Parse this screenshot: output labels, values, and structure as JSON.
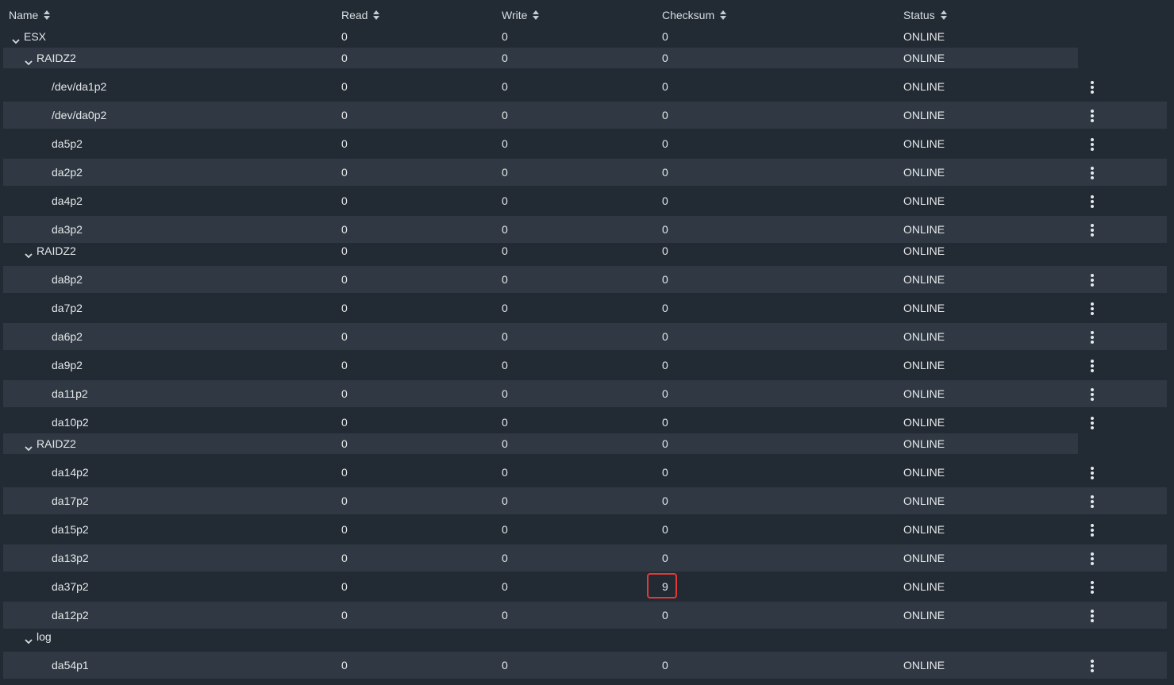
{
  "columns": {
    "name": "Name",
    "read": "Read",
    "write": "Write",
    "checksum": "Checksum",
    "status": "Status"
  },
  "accent": {
    "highlight_border": "#e53935",
    "row_alt_bg": "#303943",
    "page_bg": "#222a33"
  },
  "rows": [
    {
      "kind": "pool",
      "name": "ESX",
      "read": "0",
      "write": "0",
      "checksum": "0",
      "status": "ONLINE"
    },
    {
      "kind": "vdev",
      "name": "RAIDZ2",
      "read": "0",
      "write": "0",
      "checksum": "0",
      "status": "ONLINE"
    },
    {
      "kind": "disk",
      "name": "/dev/da1p2",
      "read": "0",
      "write": "0",
      "checksum": "0",
      "status": "ONLINE"
    },
    {
      "kind": "disk",
      "name": "/dev/da0p2",
      "read": "0",
      "write": "0",
      "checksum": "0",
      "status": "ONLINE"
    },
    {
      "kind": "disk",
      "name": "da5p2",
      "read": "0",
      "write": "0",
      "checksum": "0",
      "status": "ONLINE"
    },
    {
      "kind": "disk",
      "name": "da2p2",
      "read": "0",
      "write": "0",
      "checksum": "0",
      "status": "ONLINE"
    },
    {
      "kind": "disk",
      "name": "da4p2",
      "read": "0",
      "write": "0",
      "checksum": "0",
      "status": "ONLINE"
    },
    {
      "kind": "disk",
      "name": "da3p2",
      "read": "0",
      "write": "0",
      "checksum": "0",
      "status": "ONLINE"
    },
    {
      "kind": "vdev",
      "name": "RAIDZ2",
      "read": "0",
      "write": "0",
      "checksum": "0",
      "status": "ONLINE"
    },
    {
      "kind": "disk",
      "name": "da8p2",
      "read": "0",
      "write": "0",
      "checksum": "0",
      "status": "ONLINE"
    },
    {
      "kind": "disk",
      "name": "da7p2",
      "read": "0",
      "write": "0",
      "checksum": "0",
      "status": "ONLINE"
    },
    {
      "kind": "disk",
      "name": "da6p2",
      "read": "0",
      "write": "0",
      "checksum": "0",
      "status": "ONLINE"
    },
    {
      "kind": "disk",
      "name": "da9p2",
      "read": "0",
      "write": "0",
      "checksum": "0",
      "status": "ONLINE"
    },
    {
      "kind": "disk",
      "name": "da11p2",
      "read": "0",
      "write": "0",
      "checksum": "0",
      "status": "ONLINE"
    },
    {
      "kind": "disk",
      "name": "da10p2",
      "read": "0",
      "write": "0",
      "checksum": "0",
      "status": "ONLINE"
    },
    {
      "kind": "vdev",
      "name": "RAIDZ2",
      "read": "0",
      "write": "0",
      "checksum": "0",
      "status": "ONLINE"
    },
    {
      "kind": "disk",
      "name": "da14p2",
      "read": "0",
      "write": "0",
      "checksum": "0",
      "status": "ONLINE"
    },
    {
      "kind": "disk",
      "name": "da17p2",
      "read": "0",
      "write": "0",
      "checksum": "0",
      "status": "ONLINE"
    },
    {
      "kind": "disk",
      "name": "da15p2",
      "read": "0",
      "write": "0",
      "checksum": "0",
      "status": "ONLINE"
    },
    {
      "kind": "disk",
      "name": "da13p2",
      "read": "0",
      "write": "0",
      "checksum": "0",
      "status": "ONLINE"
    },
    {
      "kind": "disk",
      "name": "da37p2",
      "read": "0",
      "write": "0",
      "checksum": "9",
      "status": "ONLINE",
      "highlighted": true
    },
    {
      "kind": "disk",
      "name": "da12p2",
      "read": "0",
      "write": "0",
      "checksum": "0",
      "status": "ONLINE"
    },
    {
      "kind": "vdev",
      "name": "log",
      "read": "",
      "write": "",
      "checksum": "",
      "status": ""
    },
    {
      "kind": "disk",
      "name": "da54p1",
      "read": "0",
      "write": "0",
      "checksum": "0",
      "status": "ONLINE"
    }
  ]
}
